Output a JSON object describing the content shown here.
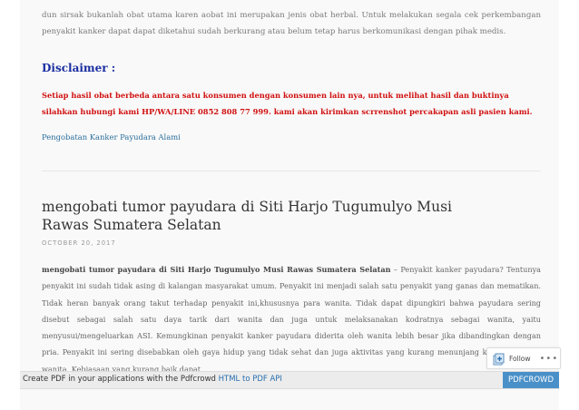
{
  "article": {
    "intro_text": "dun sirsak bukanlah obat utama karen aobat ini merupakan jenis obat herbal. Untuk melakukan segala cek perkembangan penyakit kanker dapat dapat diketahui sudah berkurang atau belum tetap harus berkomunikasi dengan pihak medis.",
    "disclaimer_heading": "Disclaimer :",
    "disclaimer_text": "Setiap hasil obat berbeda antara satu konsumen dengan konsumen lain nya, untuk melihat hasil dan buktinya silahkan hubungi kami HP/WA/LINE 0852 808 77 999. kami akan kirimkan scrrenshot percakapan asli pasien kami.",
    "related_link": "Pengobatan Kanker Payudara Alami"
  },
  "post": {
    "title": "mengobati tumor payudara di Siti Harjo Tugumulyo Musi Rawas Sumatera Selatan",
    "date": "OCTOBER 20, 2017",
    "lead_bold": "mengobati tumor payudara di Siti Harjo Tugumulyo Musi Rawas Sumatera Selatan",
    "body_text": " – Penyakit kanker payudara? Tentunya penyakit ini sudah tidak asing di kalangan masyarakat umum. Penyakit ini menjadi salah satu penyakit yang ganas dan mematikan. Tidak heran banyak orang takut terhadap penyakit ini,khususnya para wanita. Tidak dapat dipungkiri bahwa payudara sering disebut sebagai salah satu daya tarik dari wanita dan juga untuk melaksanakan kodratnya sebagai wanita, yaitu menyusui/mengeluarkan ASI. Kemungkinan penyakit kanker payudara diderita oleh wanita lebih besar jika dibandingkan dengan pria. Penyakit ini sering disebabkan oleh gaya hidup yang tidak sehat dan juga aktivitas yang kurang menunjang kesehatan para wanita. Kebiasaan yang kurang baik dapat"
  },
  "follow_widget": {
    "label": "Follow",
    "icon": "follow-icon",
    "more": "•••"
  },
  "footer": {
    "prefix": "Create PDF in your applications with the Pdfcrowd ",
    "link": "HTML to PDF API",
    "brand": "PDFCROWD"
  },
  "colors": {
    "disclaimer_heading": "#1a2ea0",
    "disclaimer_text": "#d01010",
    "link": "#2a6f9c",
    "footer_brand_bg": "#4a90c8"
  }
}
